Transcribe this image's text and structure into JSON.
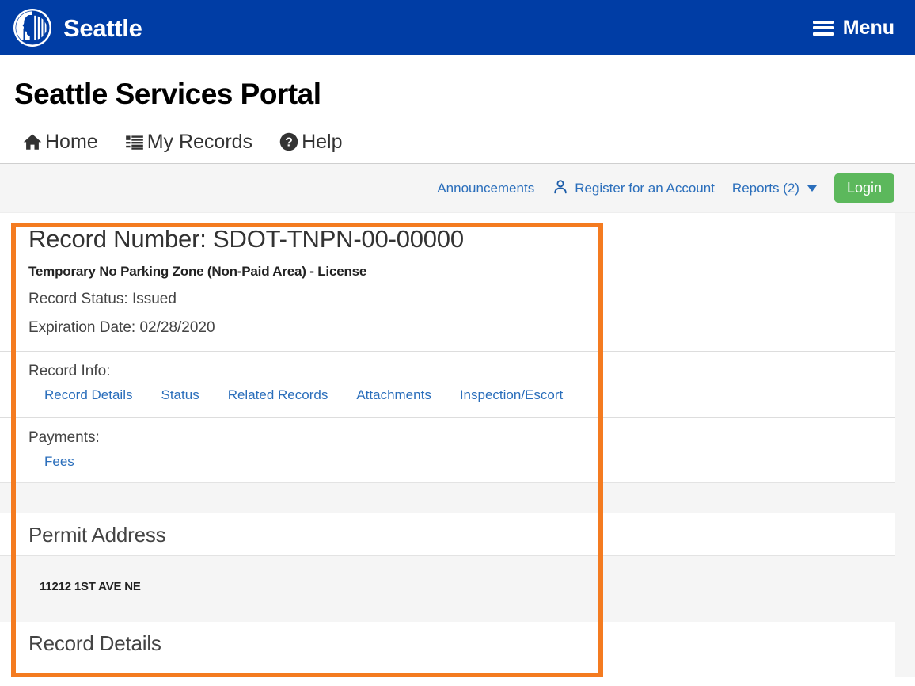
{
  "header": {
    "brand_name": "Seattle",
    "logo_icon": "seattle-city-seal-icon",
    "menu_label": "Menu",
    "menu_icon": "hamburger-icon",
    "bar_color": "#003da5"
  },
  "page": {
    "title": "Seattle Services Portal"
  },
  "main_nav": [
    {
      "label": "Home",
      "icon": "home-icon"
    },
    {
      "label": "My Records",
      "icon": "list-icon"
    },
    {
      "label": "Help",
      "icon": "question-circle-icon"
    }
  ],
  "secondary_nav": {
    "announcements_label": "Announcements",
    "register_label": "Register for an Account",
    "register_icon": "person-icon",
    "reports_label": "Reports (2)",
    "reports_caret_icon": "chevron-down-icon",
    "login_label": "Login",
    "login_color": "#5cb85c",
    "link_color": "#2a6ebb"
  },
  "record": {
    "number_label": "Record Number:",
    "number_value": "SDOT-TNPN-00-00000",
    "subtitle": "Temporary No Parking Zone (Non-Paid Area) - License",
    "status_label": "Record Status:",
    "status_value": "Issued",
    "expiration_label": "Expiration Date:",
    "expiration_value": "02/28/2020",
    "record_info_label": "Record Info:",
    "record_info_links": [
      "Record Details",
      "Status",
      "Related Records",
      "Attachments",
      "Inspection/Escort"
    ],
    "payments_label": "Payments:",
    "payments_links": [
      "Fees"
    ]
  },
  "permit_address": {
    "heading": "Permit Address",
    "address": "11212 1ST AVE NE"
  },
  "record_details": {
    "heading": "Record Details"
  },
  "highlight": {
    "color": "#f47b20"
  }
}
